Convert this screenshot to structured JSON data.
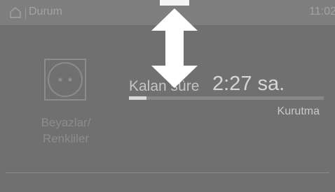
{
  "header": {
    "home_icon": "home-icon",
    "title": "Durum",
    "time": "11:02"
  },
  "program": {
    "icon": "cotton-care-symbol",
    "label_line1": "Beyazlar/",
    "label_line2": "Renkliler"
  },
  "status": {
    "remaining_label": "Kalan süre",
    "remaining_value": "2:27 sa.",
    "progress_percent": 9,
    "phase": "Kurutma"
  },
  "overlay": {
    "gesture_icon": "vertical-double-arrow-icon"
  },
  "colors": {
    "background": "#707070",
    "header_background": "#7e7e7e",
    "text_primary": "#d6d6d6",
    "text_dimmed": "#8c8c8c",
    "progress_fill": "#d9d9d9",
    "arrow": "#ffffff"
  }
}
